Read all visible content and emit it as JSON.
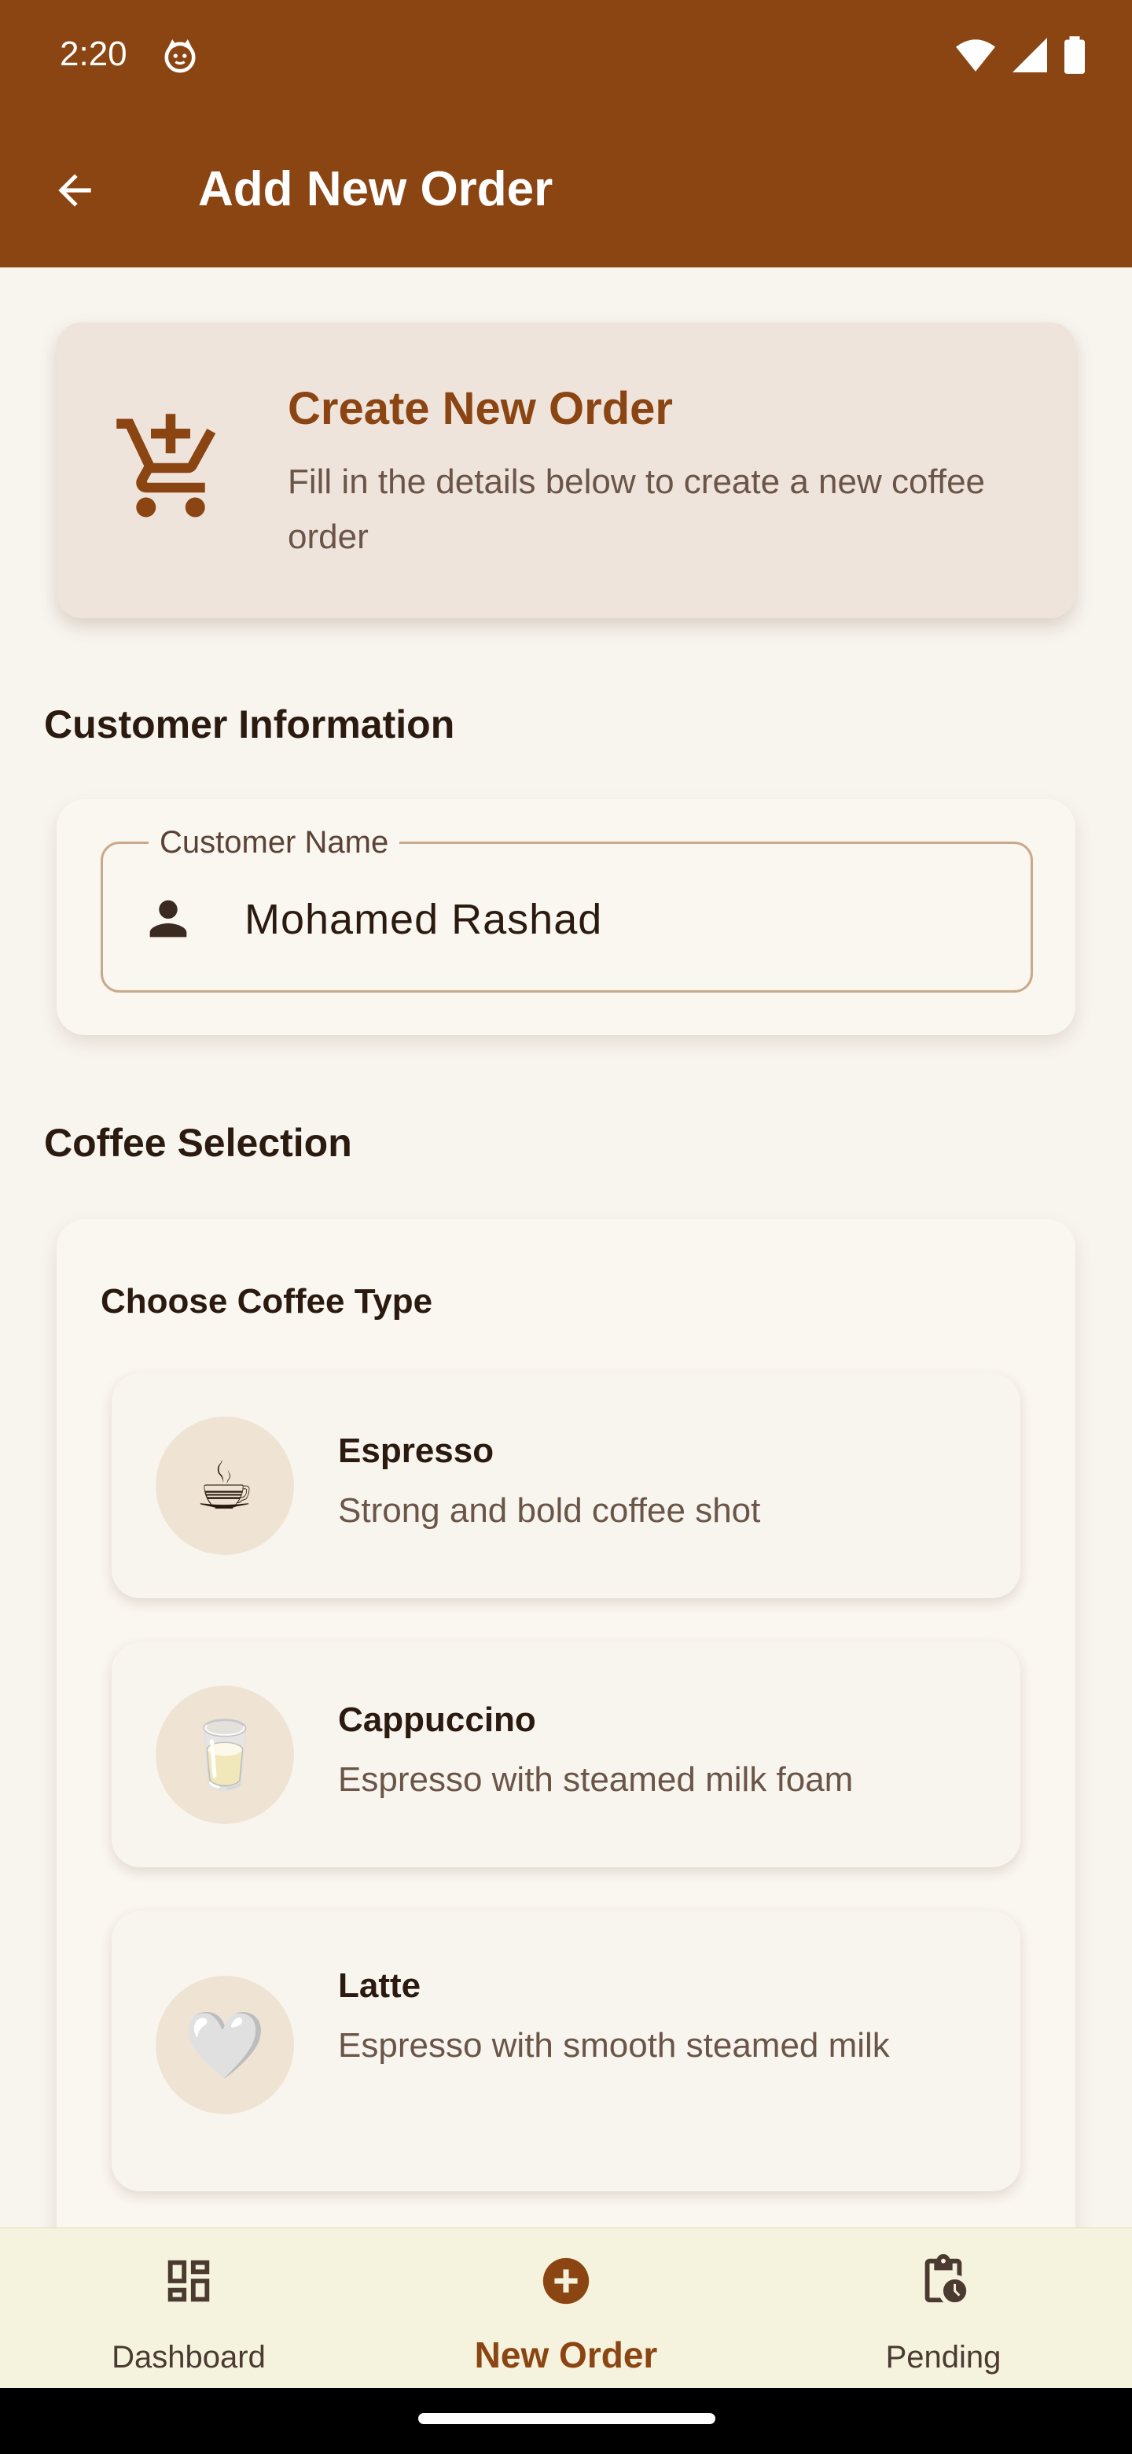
{
  "status_bar": {
    "time": "2:20"
  },
  "app_bar": {
    "title": "Add New Order"
  },
  "hero": {
    "title": "Create New Order",
    "description": "Fill in the details below to create a new coffee order"
  },
  "customer_section": {
    "title": "Customer Information",
    "field_label": "Customer Name",
    "field_value": "Mohamed Rashad"
  },
  "coffee_section": {
    "title": "Coffee Selection",
    "choose_label": "Choose Coffee Type",
    "items": [
      {
        "name": "Espresso",
        "description": "Strong and bold coffee shot",
        "emoji": "☕"
      },
      {
        "name": "Cappuccino",
        "description": "Espresso with steamed milk foam",
        "emoji": "🥛"
      },
      {
        "name": "Latte",
        "description": "Espresso with smooth steamed milk",
        "emoji": "🤍"
      }
    ]
  },
  "bottom_nav": {
    "items": [
      {
        "label": "Dashboard",
        "icon": "dashboard-icon",
        "active": false
      },
      {
        "label": "New Order",
        "icon": "add-circle-icon",
        "active": true
      },
      {
        "label": "Pending",
        "icon": "pending-clipboard-icon",
        "active": false
      }
    ]
  },
  "colors": {
    "primary": "#8B4513",
    "background": "#F8F5EF",
    "hero_card": "#EFE4DB",
    "nav_background": "#F5F2DE",
    "field_border": "#C9A98A"
  }
}
